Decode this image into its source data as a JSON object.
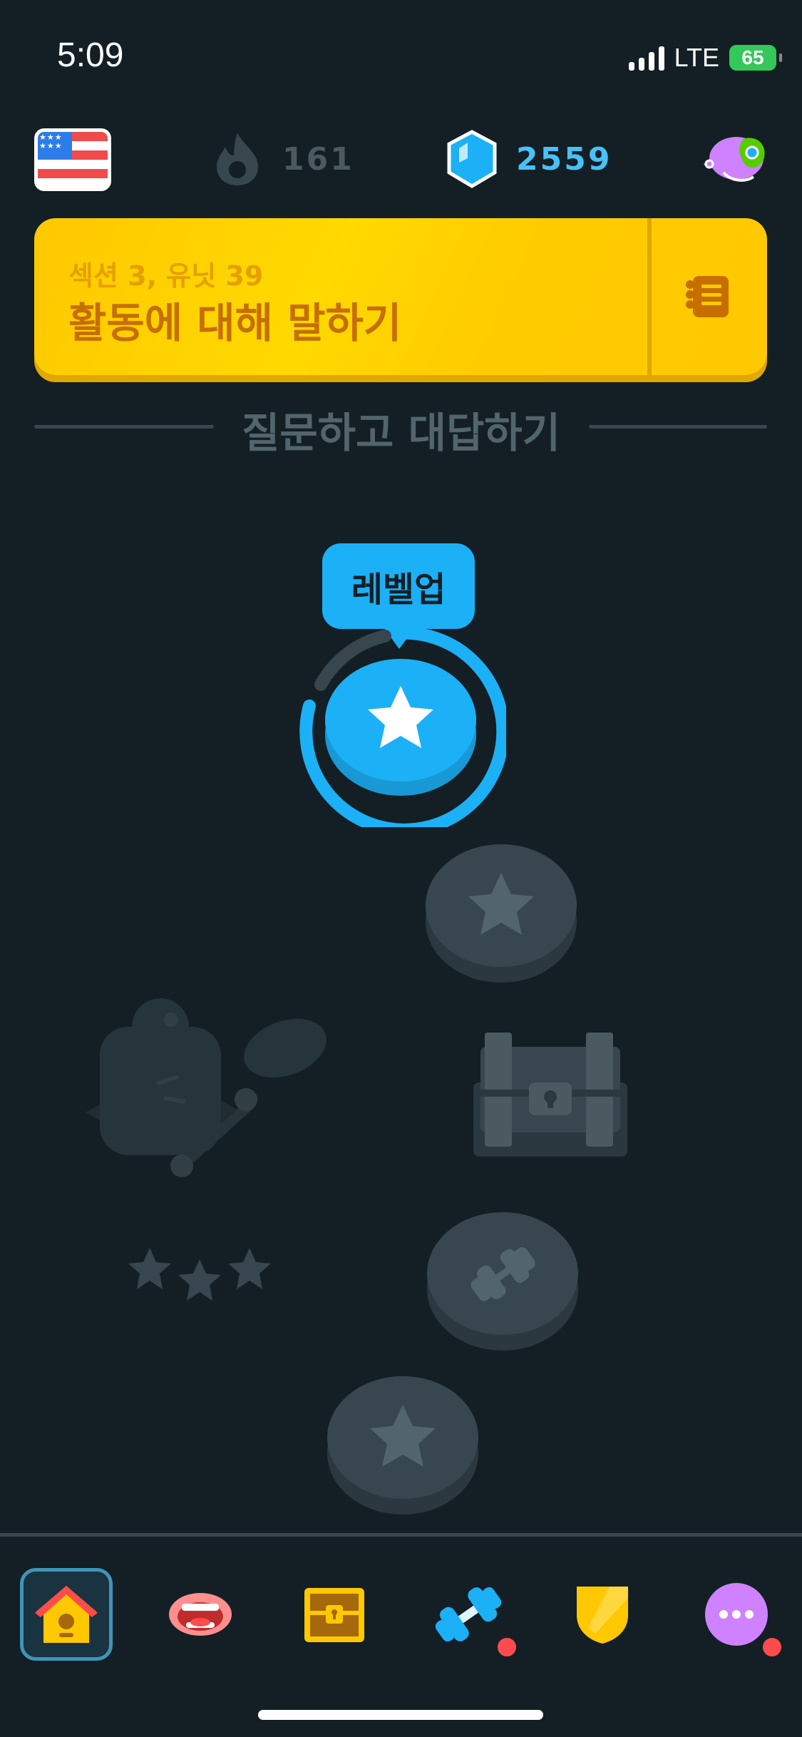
{
  "status_bar": {
    "time": "5:09",
    "network": "LTE",
    "battery": "65"
  },
  "header": {
    "streak": "161",
    "gems": "2559"
  },
  "unit_banner": {
    "subtitle": "섹션 3, 유닛 39",
    "title": "활동에 대해 말하기"
  },
  "section": {
    "title": "질문하고 대답하기"
  },
  "current_node": {
    "tooltip": "레벨업"
  },
  "colors": {
    "background": "#131f24",
    "accent_blue": "#1cb0f6",
    "banner_yellow": "#ffc800",
    "locked_gray": "#37464f"
  },
  "nav": {
    "items": [
      {
        "icon": "home-icon",
        "active": true
      },
      {
        "icon": "speaking-mouth-icon"
      },
      {
        "icon": "treasure-chest-icon"
      },
      {
        "icon": "dumbbell-practice-icon",
        "badge": true
      },
      {
        "icon": "league-shield-icon"
      },
      {
        "icon": "more-icon",
        "badge": true
      }
    ]
  }
}
